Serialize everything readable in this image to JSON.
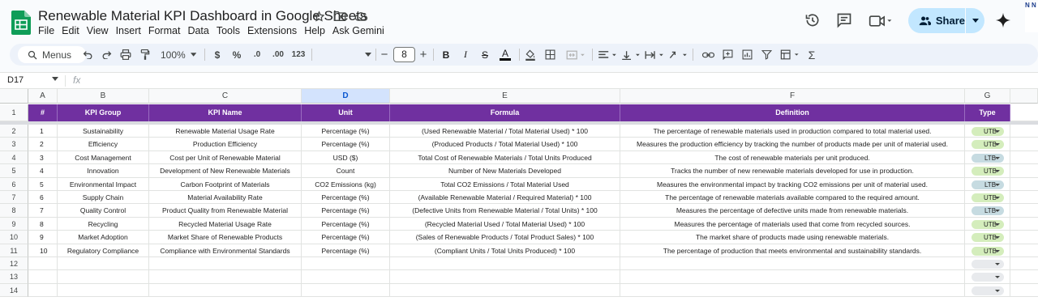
{
  "doc": {
    "title": "Renewable Material KPI Dashboard in Google Sheets",
    "menu": [
      "File",
      "Edit",
      "View",
      "Insert",
      "Format",
      "Data",
      "Tools",
      "Extensions",
      "Help",
      "Ask Gemini"
    ],
    "share_label": "Share",
    "avatar_text": "N N"
  },
  "toolbar": {
    "search_label": "Menus",
    "zoom": "100%",
    "currency": "$",
    "percent": "%",
    "dec_decrease": ".0",
    "dec_increase": ".00",
    "number_format": "123",
    "font_size": "8",
    "minus": "−",
    "plus": "+",
    "bold": "B",
    "italic": "I",
    "strike": "S",
    "text_color": "A",
    "functions": "Σ"
  },
  "formula_bar": {
    "cell_ref": "D17",
    "fx": "fx"
  },
  "columns": [
    "A",
    "B",
    "C",
    "D",
    "E",
    "F",
    "G"
  ],
  "selected_column": "D",
  "header_row": [
    "#",
    "KPI Group",
    "KPI Name",
    "Unit",
    "Formula",
    "Definition",
    "Type"
  ],
  "row_numbers": [
    "1",
    "2",
    "3",
    "4",
    "5",
    "6",
    "7",
    "8",
    "9",
    "10",
    "11",
    "12",
    "13",
    "14"
  ],
  "rows": [
    {
      "num": "1",
      "group": "Sustainability",
      "name": "Renewable Material Usage Rate",
      "unit": "Percentage (%)",
      "formula": "(Used Renewable Material / Total Material Used) * 100",
      "definition": "The percentage of renewable materials used in production compared to total material used.",
      "type": "UTB"
    },
    {
      "num": "2",
      "group": "Efficiency",
      "name": "Production Efficiency",
      "unit": "Percentage (%)",
      "formula": "(Produced Products / Total Material Used) * 100",
      "definition": "Measures the production efficiency by tracking the number of products made per unit of material used.",
      "type": "UTB"
    },
    {
      "num": "3",
      "group": "Cost Management",
      "name": "Cost per Unit of Renewable Material",
      "unit": "USD ($)",
      "formula": "Total Cost of Renewable Materials / Total Units Produced",
      "definition": "The cost of renewable materials per unit produced.",
      "type": "LTB"
    },
    {
      "num": "4",
      "group": "Innovation",
      "name": "Development of New Renewable Materials",
      "unit": "Count",
      "formula": "Number of New Materials Developed",
      "definition": "Tracks the number of new renewable materials developed for use in production.",
      "type": "UTB"
    },
    {
      "num": "5",
      "group": "Environmental Impact",
      "name": "Carbon Footprint of Materials",
      "unit": "CO2 Emissions (kg)",
      "formula": "Total CO2 Emissions / Total Material Used",
      "definition": "Measures the environmental impact by tracking CO2 emissions per unit of material used.",
      "type": "LTB"
    },
    {
      "num": "6",
      "group": "Supply Chain",
      "name": "Material Availability Rate",
      "unit": "Percentage (%)",
      "formula": "(Available Renewable Material / Required Material) * 100",
      "definition": "The percentage of renewable materials available compared to the required amount.",
      "type": "UTB"
    },
    {
      "num": "7",
      "group": "Quality Control",
      "name": "Product Quality from Renewable Material",
      "unit": "Percentage (%)",
      "formula": "(Defective Units from Renewable Material / Total Units) * 100",
      "definition": "Measures the percentage of defective units made from renewable materials.",
      "type": "LTB"
    },
    {
      "num": "8",
      "group": "Recycling",
      "name": "Recycled Material Usage Rate",
      "unit": "Percentage (%)",
      "formula": "(Recycled Material Used / Total Material Used) * 100",
      "definition": "Measures the percentage of materials used that come from recycled sources.",
      "type": "UTB"
    },
    {
      "num": "9",
      "group": "Market Adoption",
      "name": "Market Share of Renewable Products",
      "unit": "Percentage (%)",
      "formula": "(Sales of Renewable Products / Total Product Sales) * 100",
      "definition": "The market share of products made using renewable materials.",
      "type": "UTB"
    },
    {
      "num": "10",
      "group": "Regulatory Compliance",
      "name": "Compliance with Environmental Standards",
      "unit": "Percentage (%)",
      "formula": "(Compliant Units / Total Units Produced) * 100",
      "definition": "The percentage of production that meets environmental and sustainability standards.",
      "type": "UTB"
    }
  ],
  "colors": {
    "header_purple": "#7030a0",
    "utb_chip": "#d4edbc",
    "ltb_chip": "#c6dbe1",
    "share_blue": "#c2e7ff"
  }
}
